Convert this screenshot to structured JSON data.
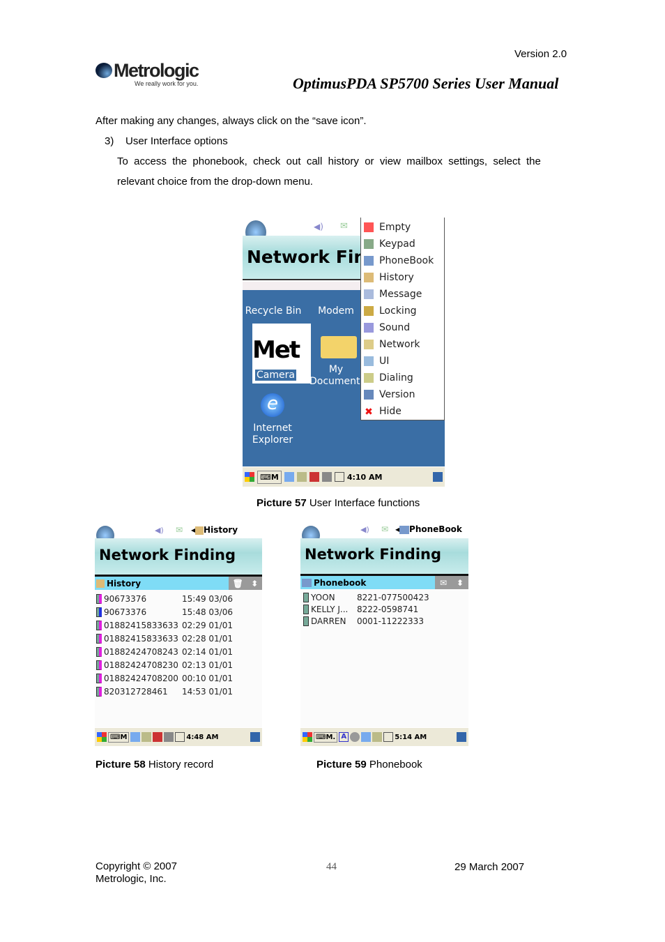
{
  "header": {
    "version": "Version 2.0",
    "logo_text": "Metrologic",
    "logo_tagline": "We really work for you.",
    "manual_title": "OptimusPDA SP5700 Series User Manual"
  },
  "body": {
    "p1": "After making any changes, always click on the “save icon”.",
    "item_num": "3)",
    "item_label": "User Interface options",
    "p2_line1": "To  access  the  phonebook,  check  out  call  history  or  view  mailbox  settings,  select  the",
    "p2_line2": "relevant choice from the drop-down menu."
  },
  "screen57": {
    "app_title": "Network Finding",
    "desktop_icons": [
      "Recycle Bin",
      "Modem",
      "Camera",
      "My Documents",
      "Internet Explorer"
    ],
    "menu": [
      "Empty",
      "Keypad",
      "PhoneBook",
      "History",
      "Message",
      "Locking",
      "Sound",
      "Network",
      "UI",
      "Dialing",
      "Version",
      "Hide"
    ],
    "taskbar_m": "M",
    "time": "4:10 AM"
  },
  "caption57": {
    "bold": "Picture 57",
    "text": " User Interface functions"
  },
  "screen58": {
    "menu_label": "History",
    "app_title": "Network Finding",
    "list_title": "History",
    "rows": [
      {
        "number": "90673376",
        "time": "15:49 03/06",
        "dir": "in"
      },
      {
        "number": "90673376",
        "time": "15:48 03/06",
        "dir": "out"
      },
      {
        "number": "01882415833633",
        "time": "02:29 01/01",
        "dir": "in"
      },
      {
        "number": "01882415833633",
        "time": "02:28 01/01",
        "dir": "in"
      },
      {
        "number": "01882424708243",
        "time": "02:14 01/01",
        "dir": "in"
      },
      {
        "number": "01882424708230",
        "time": "02:13 01/01",
        "dir": "in"
      },
      {
        "number": "01882424708200",
        "time": "00:10 01/01",
        "dir": "in"
      },
      {
        "number": "820312728461",
        "time": "14:53 01/01",
        "dir": "in"
      }
    ],
    "taskbar_m": "M",
    "time": "4:48 AM"
  },
  "caption58": {
    "bold": "Picture 58",
    "text": " History record"
  },
  "screen59": {
    "menu_label": "PhoneBook",
    "app_title": "Network Finding",
    "list_title": "Phonebook",
    "rows": [
      {
        "name": "YOON",
        "number": "8221-077500423"
      },
      {
        "name": "KELLY J...",
        "number": "8222-0598741"
      },
      {
        "name": "DARREN",
        "number": "0001-11222333"
      }
    ],
    "taskbar_m": "M.",
    "time": "5:14 AM"
  },
  "caption59": {
    "bold": "Picture 59",
    "text": " Phonebook"
  },
  "footer": {
    "copyright": "Copyright © 2007",
    "company": "Metrologic, Inc.",
    "page": "44",
    "date": "29 March 2007"
  },
  "colors": {
    "desktop": "#3a6ea5",
    "list_header": "#7fdcf6",
    "incoming": "#e020e0",
    "outgoing": "#2030e0"
  }
}
